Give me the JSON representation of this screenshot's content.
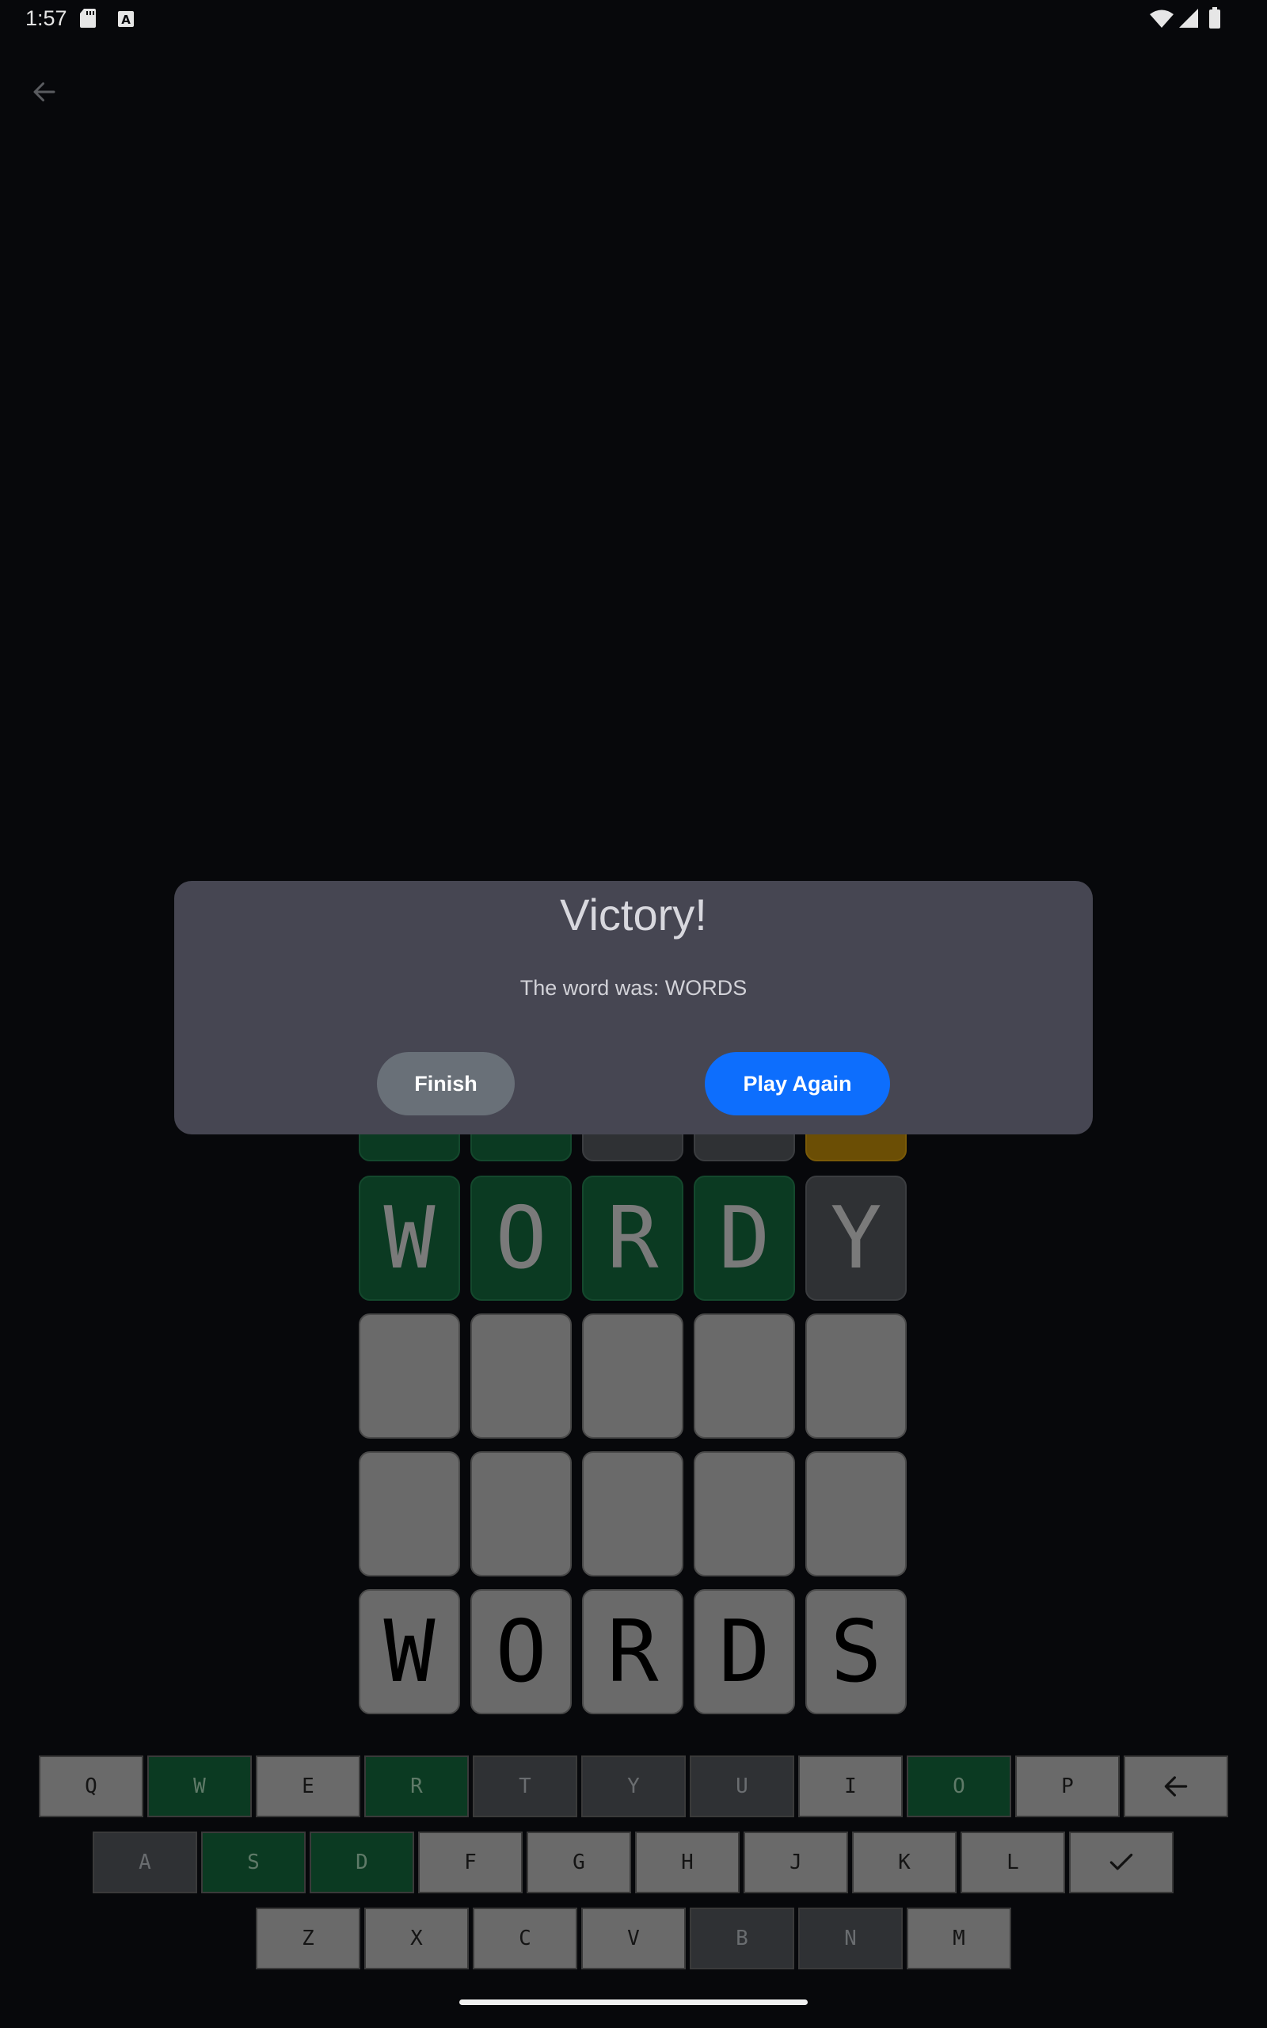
{
  "status_bar": {
    "time": "1:57",
    "icons": [
      "sd-card-icon",
      "keyboard-a-icon",
      "wifi-icon",
      "cell-signal-icon",
      "battery-icon"
    ]
  },
  "toolbar": {
    "back_icon": "arrow-left-icon"
  },
  "board": {
    "rows": [
      {
        "state": "partially-hidden",
        "tiles": [
          {
            "letter": "",
            "state": "correct"
          },
          {
            "letter": "",
            "state": "correct"
          },
          {
            "letter": "",
            "state": "absent"
          },
          {
            "letter": "",
            "state": "absent"
          },
          {
            "letter": "",
            "state": "present"
          }
        ]
      },
      {
        "tiles": [
          {
            "letter": "W",
            "state": "correct"
          },
          {
            "letter": "O",
            "state": "correct"
          },
          {
            "letter": "R",
            "state": "correct"
          },
          {
            "letter": "D",
            "state": "correct"
          },
          {
            "letter": "Y",
            "state": "absent"
          }
        ]
      },
      {
        "tiles": [
          {
            "letter": "",
            "state": "empty"
          },
          {
            "letter": "",
            "state": "empty"
          },
          {
            "letter": "",
            "state": "empty"
          },
          {
            "letter": "",
            "state": "empty"
          },
          {
            "letter": "",
            "state": "empty"
          }
        ]
      },
      {
        "tiles": [
          {
            "letter": "",
            "state": "empty"
          },
          {
            "letter": "",
            "state": "empty"
          },
          {
            "letter": "",
            "state": "empty"
          },
          {
            "letter": "",
            "state": "empty"
          },
          {
            "letter": "",
            "state": "empty"
          }
        ]
      },
      {
        "tiles": [
          {
            "letter": "W",
            "state": "input"
          },
          {
            "letter": "O",
            "state": "input"
          },
          {
            "letter": "R",
            "state": "input"
          },
          {
            "letter": "D",
            "state": "input"
          },
          {
            "letter": "S",
            "state": "input"
          }
        ]
      }
    ]
  },
  "keyboard": {
    "row1": [
      {
        "label": "Q",
        "state": "unused"
      },
      {
        "label": "W",
        "state": "correct"
      },
      {
        "label": "E",
        "state": "unused"
      },
      {
        "label": "R",
        "state": "correct"
      },
      {
        "label": "T",
        "state": "absent"
      },
      {
        "label": "Y",
        "state": "absent"
      },
      {
        "label": "U",
        "state": "absent"
      },
      {
        "label": "I",
        "state": "unused"
      },
      {
        "label": "O",
        "state": "correct"
      },
      {
        "label": "P",
        "state": "unused"
      },
      {
        "label": "",
        "state": "unused",
        "icon": "backspace-arrow-icon"
      }
    ],
    "row2": [
      {
        "label": "A",
        "state": "absent"
      },
      {
        "label": "S",
        "state": "correct"
      },
      {
        "label": "D",
        "state": "correct"
      },
      {
        "label": "F",
        "state": "unused"
      },
      {
        "label": "G",
        "state": "unused"
      },
      {
        "label": "H",
        "state": "unused"
      },
      {
        "label": "J",
        "state": "unused"
      },
      {
        "label": "K",
        "state": "unused"
      },
      {
        "label": "L",
        "state": "unused"
      },
      {
        "label": "",
        "state": "unused",
        "icon": "checkmark-icon"
      }
    ],
    "row3": [
      {
        "label": "Z",
        "state": "unused"
      },
      {
        "label": "X",
        "state": "unused"
      },
      {
        "label": "C",
        "state": "unused"
      },
      {
        "label": "V",
        "state": "unused"
      },
      {
        "label": "B",
        "state": "absent"
      },
      {
        "label": "N",
        "state": "absent"
      },
      {
        "label": "M",
        "state": "unused"
      }
    ]
  },
  "dialog": {
    "title": "Victory!",
    "message": "The word was: WORDS",
    "finish_label": "Finish",
    "play_again_label": "Play Again"
  },
  "colors": {
    "correct": "#0b3a22",
    "present": "#6b4e05",
    "absent": "#2f3134",
    "empty": "#6a6a6a",
    "primary_button": "#0d6efd",
    "secondary_button": "#697078",
    "dialog_bg": "#464652"
  }
}
